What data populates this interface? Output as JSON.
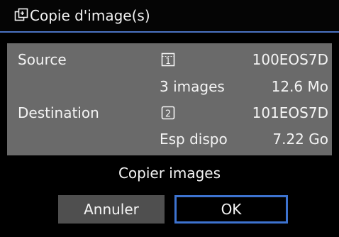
{
  "window": {
    "title": "Copie d'image(s)",
    "title_icon": "copy-images-icon"
  },
  "info": {
    "source_label": "Source",
    "source_card_icon": "card-slot-1-icon",
    "source_card_text": "1",
    "source_folder": "100EOS7D",
    "images_count": "3 images",
    "images_size": "12.6 Mo",
    "destination_label": "Destination",
    "destination_card_icon": "card-slot-2-icon",
    "destination_card_text": "2",
    "destination_folder": "101EOS7D",
    "free_space_label": "Esp dispo",
    "free_space_value": "7.22 Go"
  },
  "dialog": {
    "prompt": "Copier images",
    "cancel_label": "Annuler",
    "ok_label": "OK"
  },
  "colors": {
    "background": "#000000",
    "panel": "#6a6a6a",
    "accent": "#3d73cf",
    "cancel_button": "#4f4f4f"
  }
}
